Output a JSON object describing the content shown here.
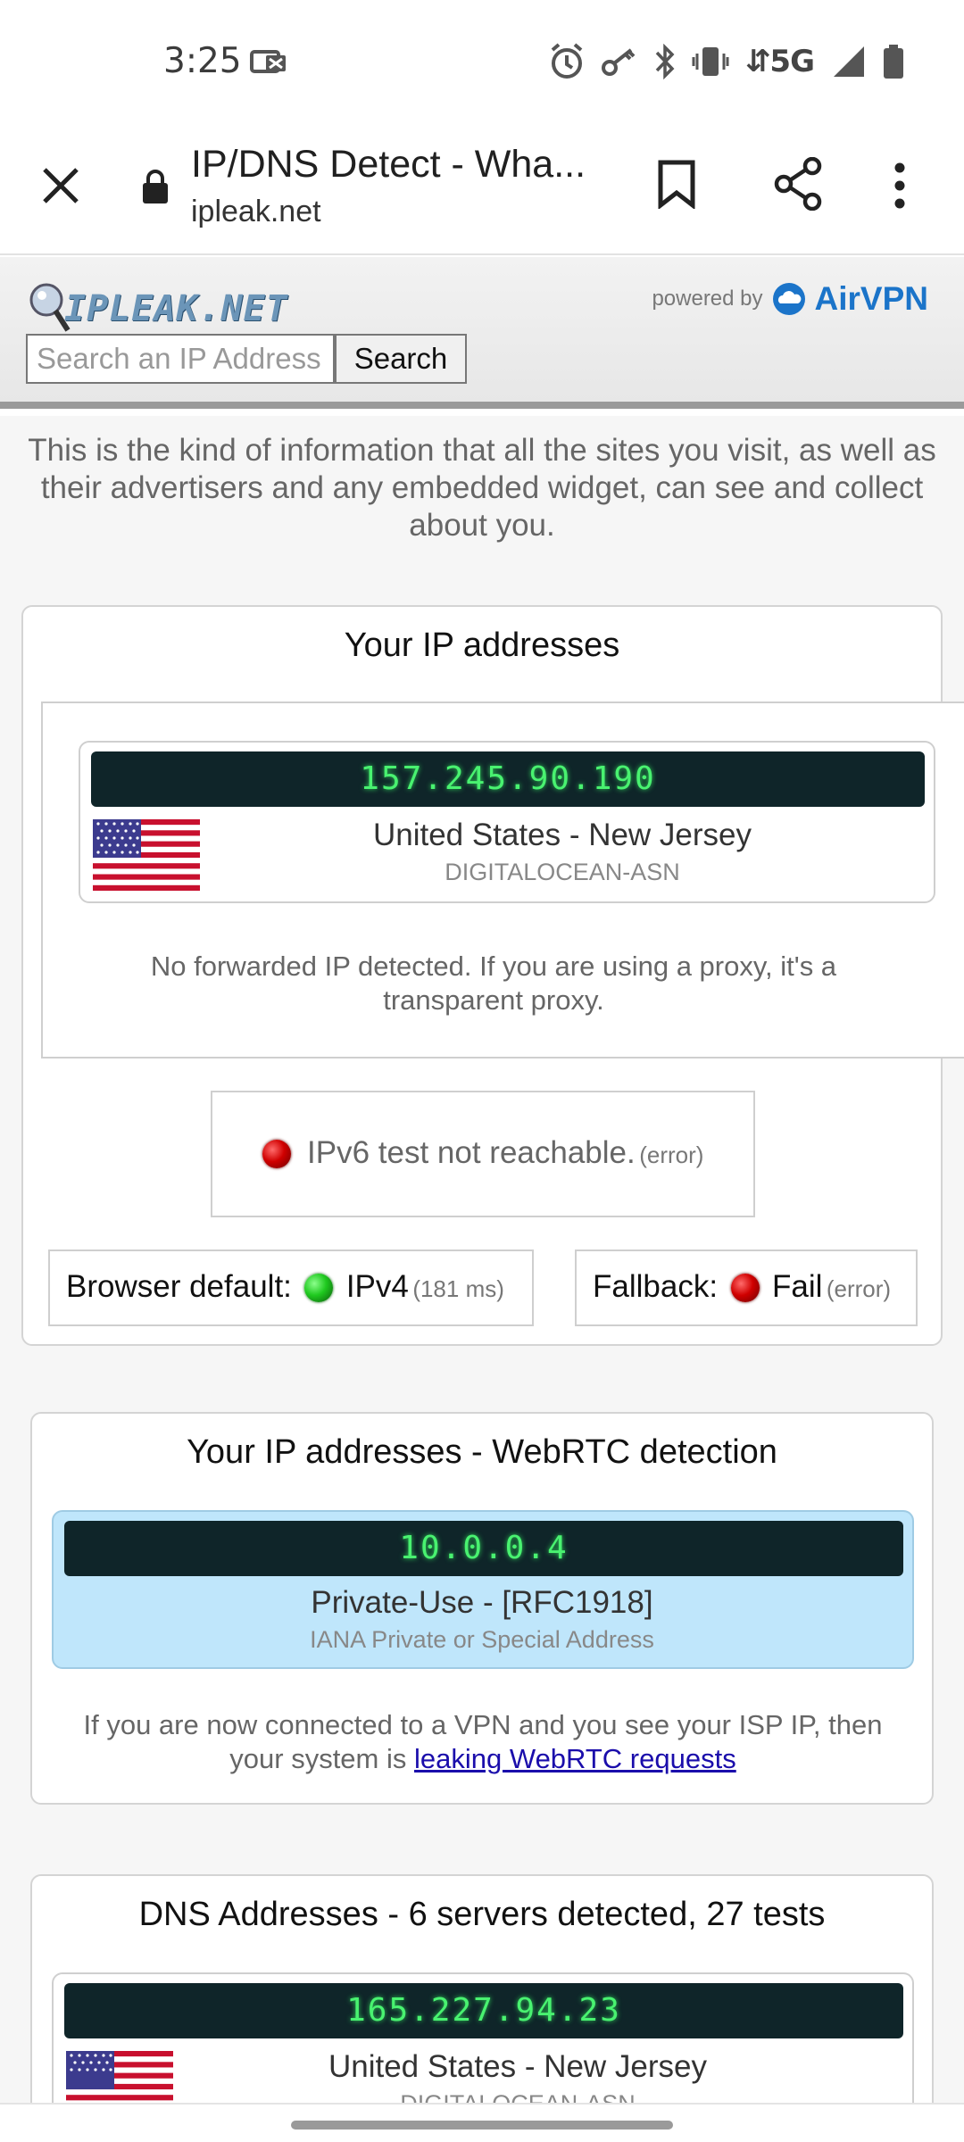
{
  "status_bar": {
    "time": "3:25",
    "network": "5G",
    "icons": [
      "notification-card-icon",
      "alarm-icon",
      "vpn-key-icon",
      "bluetooth-icon",
      "vibrate-icon",
      "signal-icon",
      "battery-icon"
    ]
  },
  "browser": {
    "page_title": "IP/DNS Detect - Wha...",
    "url": "ipleak.net",
    "icons": [
      "close-icon",
      "lock-icon",
      "bookmark-icon",
      "share-icon",
      "more-vert-icon"
    ]
  },
  "site_header": {
    "logo_text": "IPLEAK.NET",
    "powered_by": "powered by",
    "sponsor": "AirVPN",
    "search_placeholder": "Search an IP Address",
    "search_button": "Search"
  },
  "intro": "This is the kind of information that all the sites you visit, as well as their advertisers and any embedded widget, can see and collect about you.",
  "ip_section": {
    "title": "Your IP addresses",
    "ip": "157.245.90.190",
    "location": "United States - New Jersey",
    "isp": "DIGITALOCEAN-ASN",
    "forwarded_note": "No forwarded IP detected. If you are using a proxy, it's a transparent proxy.",
    "ipv6_status": "IPv6 test not reachable.",
    "ipv6_error": "(error)",
    "browser_default_label": "Browser default:",
    "browser_default_value": "IPv4",
    "browser_default_ms": "(181 ms)",
    "fallback_label": "Fallback:",
    "fallback_value": "Fail",
    "fallback_error": "(error)"
  },
  "webrtc_section": {
    "title": "Your IP addresses - WebRTC detection",
    "ip": "10.0.0.4",
    "location": "Private-Use - [RFC1918]",
    "isp": "IANA Private or Special Address",
    "note_prefix": "If you are now connected to a VPN and you see your ISP IP, then your system is",
    "note_link": "leaking WebRTC requests"
  },
  "dns_section": {
    "title": "DNS Addresses - 6 servers detected, 27 tests",
    "ip": "165.227.94.23",
    "location": "United States - New Jersey",
    "isp": "DIGITALOCEAN-ASN"
  },
  "colors": {
    "ip_display_bg": "#0f2529",
    "ip_display_text": "#49f270",
    "webrtc_box_bg": "#bfe6fb",
    "sponsor_blue": "#1b74c9"
  }
}
